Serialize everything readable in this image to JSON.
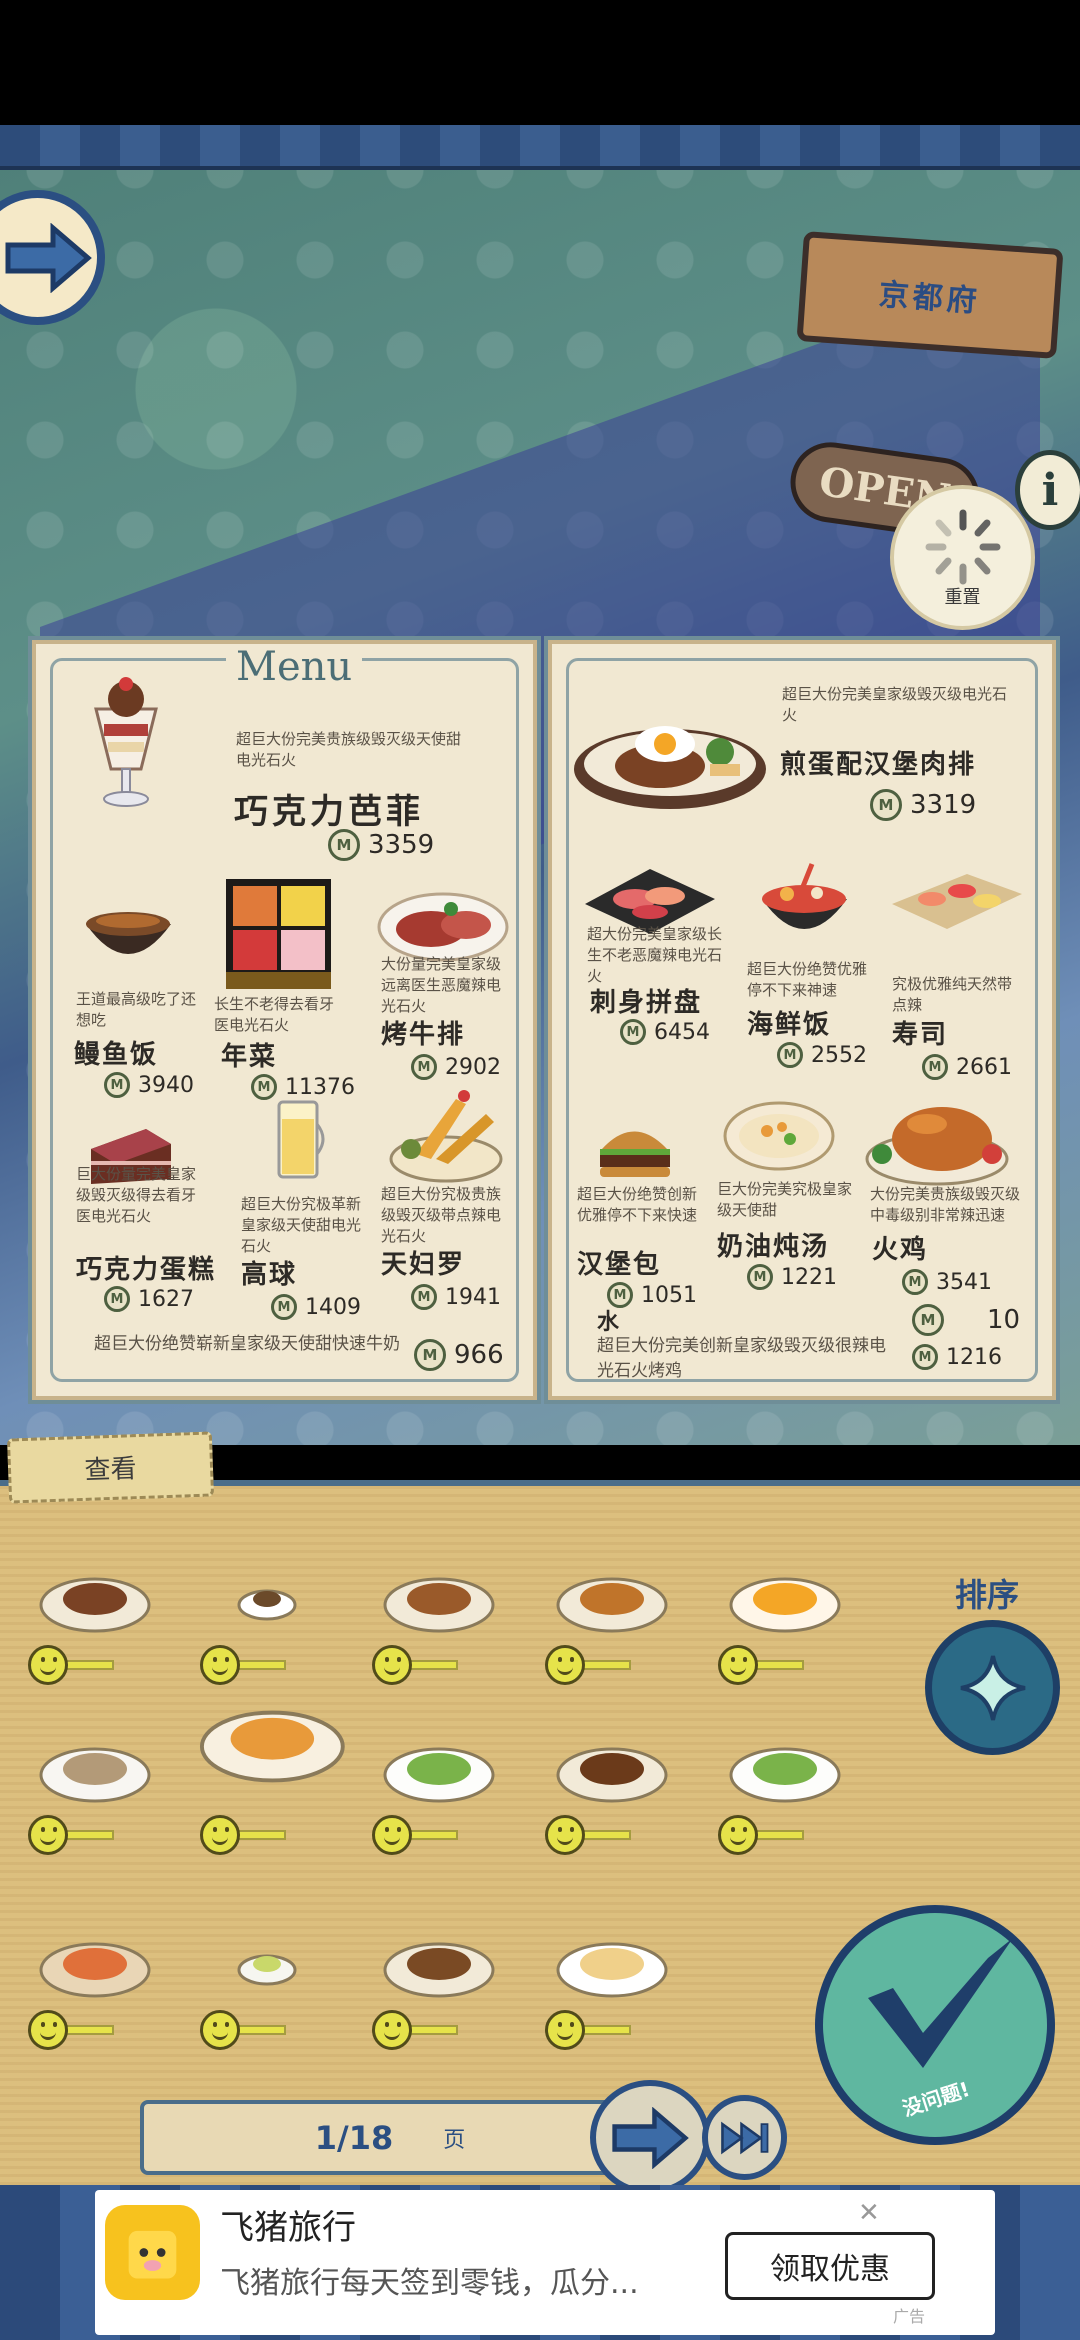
{
  "scene": {
    "sign_text": "京都府",
    "open_text": "OPEN",
    "reset_label": "重置"
  },
  "menu": {
    "title": "Menu",
    "left": [
      {
        "desc": "超巨大份完美贵族级毁灭级天使甜电光石火",
        "name": "巧克力芭菲",
        "price": "3359",
        "icon": "parfait-icon"
      },
      {
        "desc": "王道最高级吃了还想吃",
        "name": "鳗鱼饭",
        "price": "3940",
        "icon": "unagi-bowl-icon"
      },
      {
        "desc": "长生不老得去看牙医电光石火",
        "name": "年菜",
        "price": "11376",
        "icon": "osechi-box-icon"
      },
      {
        "desc": "大份量完美皇家级远离医生恶魔辣电光石火",
        "name": "烤牛排",
        "price": "2902",
        "icon": "roast-beef-icon"
      },
      {
        "desc": "巨大份量完美皇家级毁灭级得去看牙医电光石火",
        "name": "巧克力蛋糕",
        "price": "1627",
        "icon": "choc-cake-icon"
      },
      {
        "desc": "超巨大份究极革新皇家级天使甜电光石火",
        "name": "高球",
        "price": "1409",
        "icon": "highball-icon"
      },
      {
        "desc": "超巨大份究极贵族级毁灭级带点辣电光石火",
        "name": "天妇罗",
        "price": "1941",
        "icon": "tempura-icon"
      },
      {
        "desc": "超巨大份绝赞崭新皇家级天使甜快速牛奶",
        "name": "",
        "price": "966",
        "icon": ""
      }
    ],
    "right": [
      {
        "desc": "超巨大份完美皇家级毁灭级电光石火",
        "name": "煎蛋配汉堡肉排",
        "price": "3319",
        "icon": "hamburg-steak-icon"
      },
      {
        "desc": "超大份完美皇家级长生不老恶魔辣电光石火",
        "name": "刺身拼盘",
        "price": "6454",
        "icon": "sashimi-icon"
      },
      {
        "desc": "超巨大份绝赞优雅停不下来神速",
        "name": "海鲜饭",
        "price": "2552",
        "icon": "seafood-bowl-icon"
      },
      {
        "desc": "究极优雅纯天然带点辣",
        "name": "寿司",
        "price": "2661",
        "icon": "sushi-icon"
      },
      {
        "desc": "超巨大份绝赞创新优雅停不下来快速",
        "name": "汉堡包",
        "price": "1051",
        "icon": "burger-icon"
      },
      {
        "desc": "巨大份完美究极皇家级天使甜",
        "name": "奶油炖汤",
        "price": "1221",
        "icon": "cream-stew-icon"
      },
      {
        "desc": "大份完美贵族级毁灭级中毒级别非常辣迅速",
        "name": "火鸡",
        "price": "3541",
        "icon": "turkey-icon"
      },
      {
        "desc": "",
        "name": "水",
        "price": "10",
        "icon": ""
      },
      {
        "desc": "超巨大份完美创新皇家级毁灭级很辣电光石火烤鸡",
        "name": "",
        "price": "1216",
        "icon": ""
      }
    ]
  },
  "board": {
    "tab_label": "查看",
    "sort_label": "排序",
    "confirm_label": "没问题!",
    "page_current": "1/18",
    "page_unit": "页",
    "coin_symbol": "M",
    "recipes": [
      "hamburg-steak-icon",
      "coffee-cup-icon",
      "yakitori-icon",
      "small-dish-icon",
      "fried-egg-icon",
      "rice-ball-icon",
      "fried-shrimp-icon",
      "ramen-bowl-icon",
      "fried-noodles-icon",
      "ramen-bowl-icon",
      "grilled-fish-icon",
      "tea-cup-icon",
      "yakisoba-icon",
      "melon-bread-icon"
    ]
  },
  "ad": {
    "title": "飞猪旅行",
    "subtitle": "飞猪旅行每天签到零钱，瓜分...",
    "button": "领取优惠",
    "close": "✕",
    "tag": "广告"
  },
  "colors": {
    "menu_paper": "#f1e8d2",
    "board_bg": "#dcbf7e",
    "accent_blue": "#2b4f82",
    "confirm_green": "#5fb7a0"
  }
}
